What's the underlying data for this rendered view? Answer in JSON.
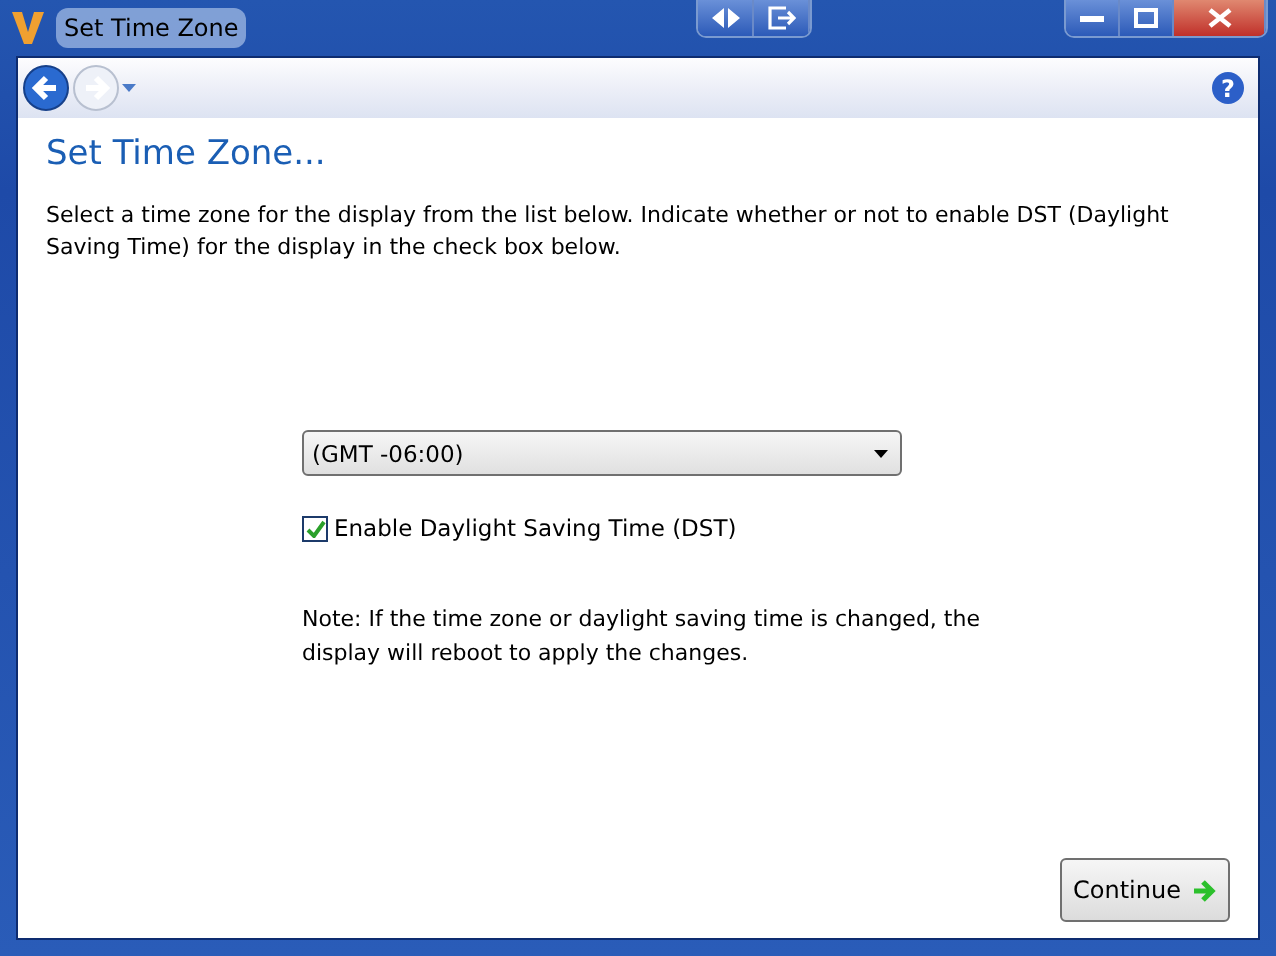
{
  "window": {
    "title": "Set Time Zone"
  },
  "help": "?",
  "heading": "Set Time Zone...",
  "description": "Select a time zone for the display from the list below. Indicate whether or not to enable DST (Daylight Saving Time) for the display in the check box below.",
  "timezone": {
    "value": "(GMT -06:00)"
  },
  "dst": {
    "label": "Enable Daylight Saving Time (DST)",
    "checked": true
  },
  "note": "Note: If the time zone or daylight saving time is changed, the display will reboot to apply the changes.",
  "buttons": [
    {
      "label": "Continue"
    }
  ]
}
